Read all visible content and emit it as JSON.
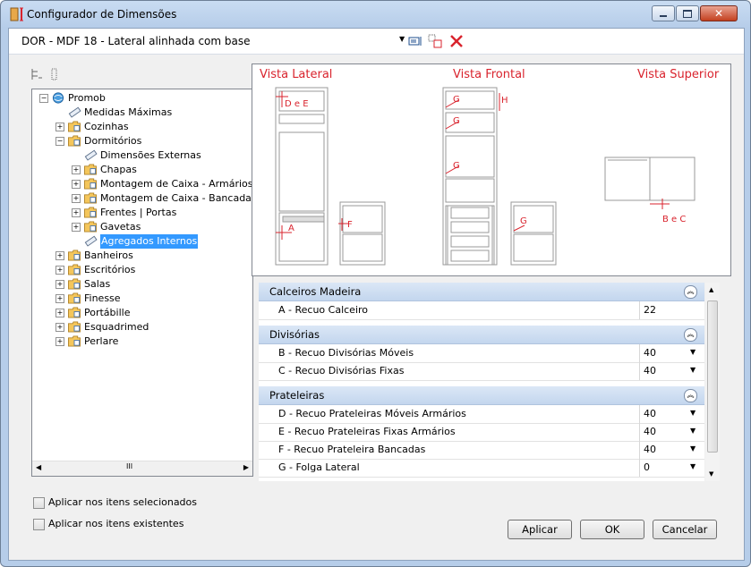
{
  "window": {
    "title": "Configurador de Dimensões"
  },
  "toolbar": {
    "selected_item": "DOR - MDF 18 - Lateral alinhada com base"
  },
  "tree": {
    "items": [
      {
        "label": "Promob",
        "level": 0
      },
      {
        "label": "Medidas Máximas",
        "level": 1
      },
      {
        "label": "Cozinhas",
        "level": 1
      },
      {
        "label": "Dormitórios",
        "level": 1
      },
      {
        "label": "Dimensões Externas",
        "level": 2
      },
      {
        "label": "Chapas",
        "level": 2
      },
      {
        "label": "Montagem de Caixa - Armários",
        "level": 2
      },
      {
        "label": "Montagem de Caixa - Bancadas",
        "level": 2
      },
      {
        "label": "Frentes | Portas",
        "level": 2
      },
      {
        "label": "Gavetas",
        "level": 2
      },
      {
        "label": "Agregados Internos",
        "level": 2,
        "selected": true
      },
      {
        "label": "Banheiros",
        "level": 1
      },
      {
        "label": "Escritórios",
        "level": 1
      },
      {
        "label": "Salas",
        "level": 1
      },
      {
        "label": "Finesse",
        "level": 1
      },
      {
        "label": "Portábille",
        "level": 1
      },
      {
        "label": "Esquadrimed",
        "level": 1
      },
      {
        "label": "Perlare",
        "level": 1
      }
    ],
    "hscroll_marker": "III"
  },
  "preview": {
    "titles": {
      "lateral": "Vista Lateral",
      "frontal": "Vista Frontal",
      "superior": "Vista Superior"
    },
    "markers": {
      "de": "D e E",
      "a": "A",
      "f": "F",
      "h": "H",
      "g": "G",
      "bc": "B e C"
    },
    "accent_color": "#d9232d"
  },
  "properties": {
    "cat1": {
      "title": "Calceiros Madeira",
      "rows": [
        {
          "label": "A - Recuo Calceiro",
          "value": "22"
        }
      ]
    },
    "cat2": {
      "title": "Divisórias",
      "rows": [
        {
          "label": "B - Recuo Divisórias Móveis",
          "value": "40"
        },
        {
          "label": "C - Recuo Divisórias Fixas",
          "value": "40"
        }
      ]
    },
    "cat3": {
      "title": "Prateleiras",
      "rows": [
        {
          "label": "D - Recuo Prateleiras Móveis Armários",
          "value": "40"
        },
        {
          "label": "E - Recuo Prateleiras Fixas Armários",
          "value": "40"
        },
        {
          "label": "F - Recuo Prateleira Bancadas",
          "value": "40"
        },
        {
          "label": "G - Folga Lateral",
          "value": "0"
        }
      ]
    }
  },
  "options": {
    "apply_selected": "Aplicar nos itens selecionados",
    "apply_existing": "Aplicar nos itens existentes"
  },
  "buttons": {
    "apply": "Aplicar",
    "ok": "OK",
    "cancel": "Cancelar"
  }
}
